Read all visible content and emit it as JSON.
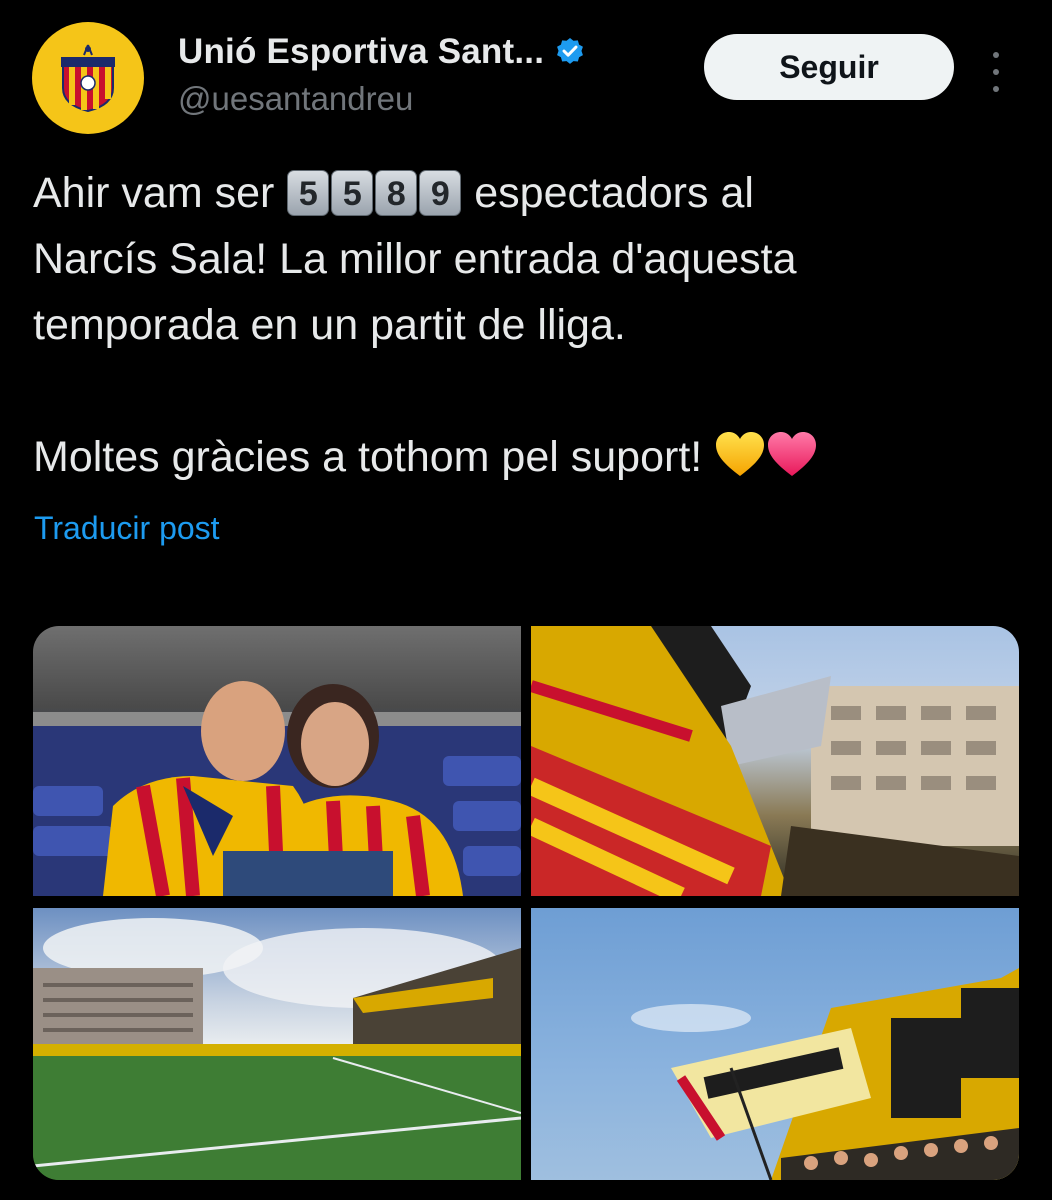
{
  "account": {
    "display_name": "Unió Esportiva Sant...",
    "handle": "@uesantandreu",
    "avatar_icon": "club-crest-icon",
    "verified_icon": "verified-badge-icon"
  },
  "follow_label": "Seguir",
  "post": {
    "line1_before": "Ahir vam ser",
    "digits": [
      "5",
      "5",
      "8",
      "9"
    ],
    "line1_after": "espectadors al",
    "line2": "Narcís Sala! La millor entrada d'aquesta",
    "line3": "temporada en un partit de lliga.",
    "line4": "Moltes gràcies a tothom pel suport!",
    "emojis": [
      "yellow-heart-icon",
      "pink-heart-icon"
    ]
  },
  "translate_label": "Traducir post",
  "colors": {
    "link": "#1d9bf0",
    "verified": "#1d9bf0",
    "avatar_bg": "#f5c518"
  }
}
